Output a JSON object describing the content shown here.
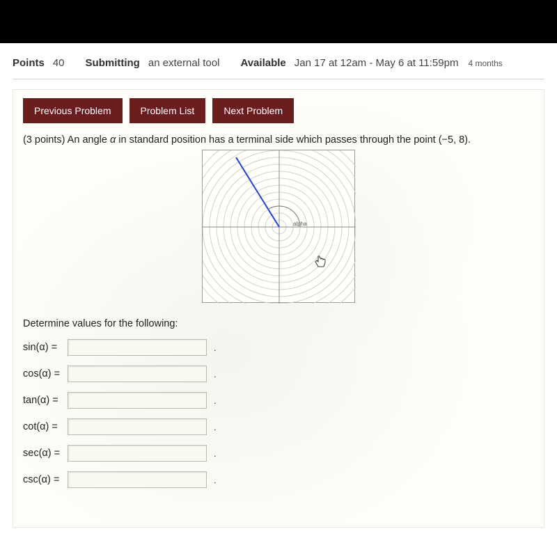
{
  "meta": {
    "points_label": "Points",
    "points_value": "40",
    "submitting_label": "Submitting",
    "submitting_value": "an external tool",
    "available_label": "Available",
    "available_value": "Jan 17 at 12am - May 6 at 11:59pm",
    "available_trail": "4 months"
  },
  "nav": {
    "prev": "Previous Problem",
    "list": "Problem List",
    "next": "Next Problem"
  },
  "problem": {
    "points_prefix": "(3 points)",
    "text_before": " An angle ",
    "alpha": "α",
    "text_after": " in standard position has a terminal side which passes through the point (−5, 8).",
    "determine": "Determine values for the following:",
    "graph_label": "alpha"
  },
  "functions": [
    {
      "label": "sin(α) =",
      "value": ""
    },
    {
      "label": "cos(α) =",
      "value": ""
    },
    {
      "label": "tan(α) =",
      "value": ""
    },
    {
      "label": "cot(α) =",
      "value": ""
    },
    {
      "label": "sec(α) =",
      "value": ""
    },
    {
      "label": "csc(α) =",
      "value": ""
    }
  ],
  "chart_data": {
    "type": "scatter",
    "title": "",
    "point": {
      "x": -5,
      "y": 8
    },
    "angle_label": "alpha",
    "xlim": [
      -10,
      10
    ],
    "ylim": [
      -10,
      10
    ]
  }
}
